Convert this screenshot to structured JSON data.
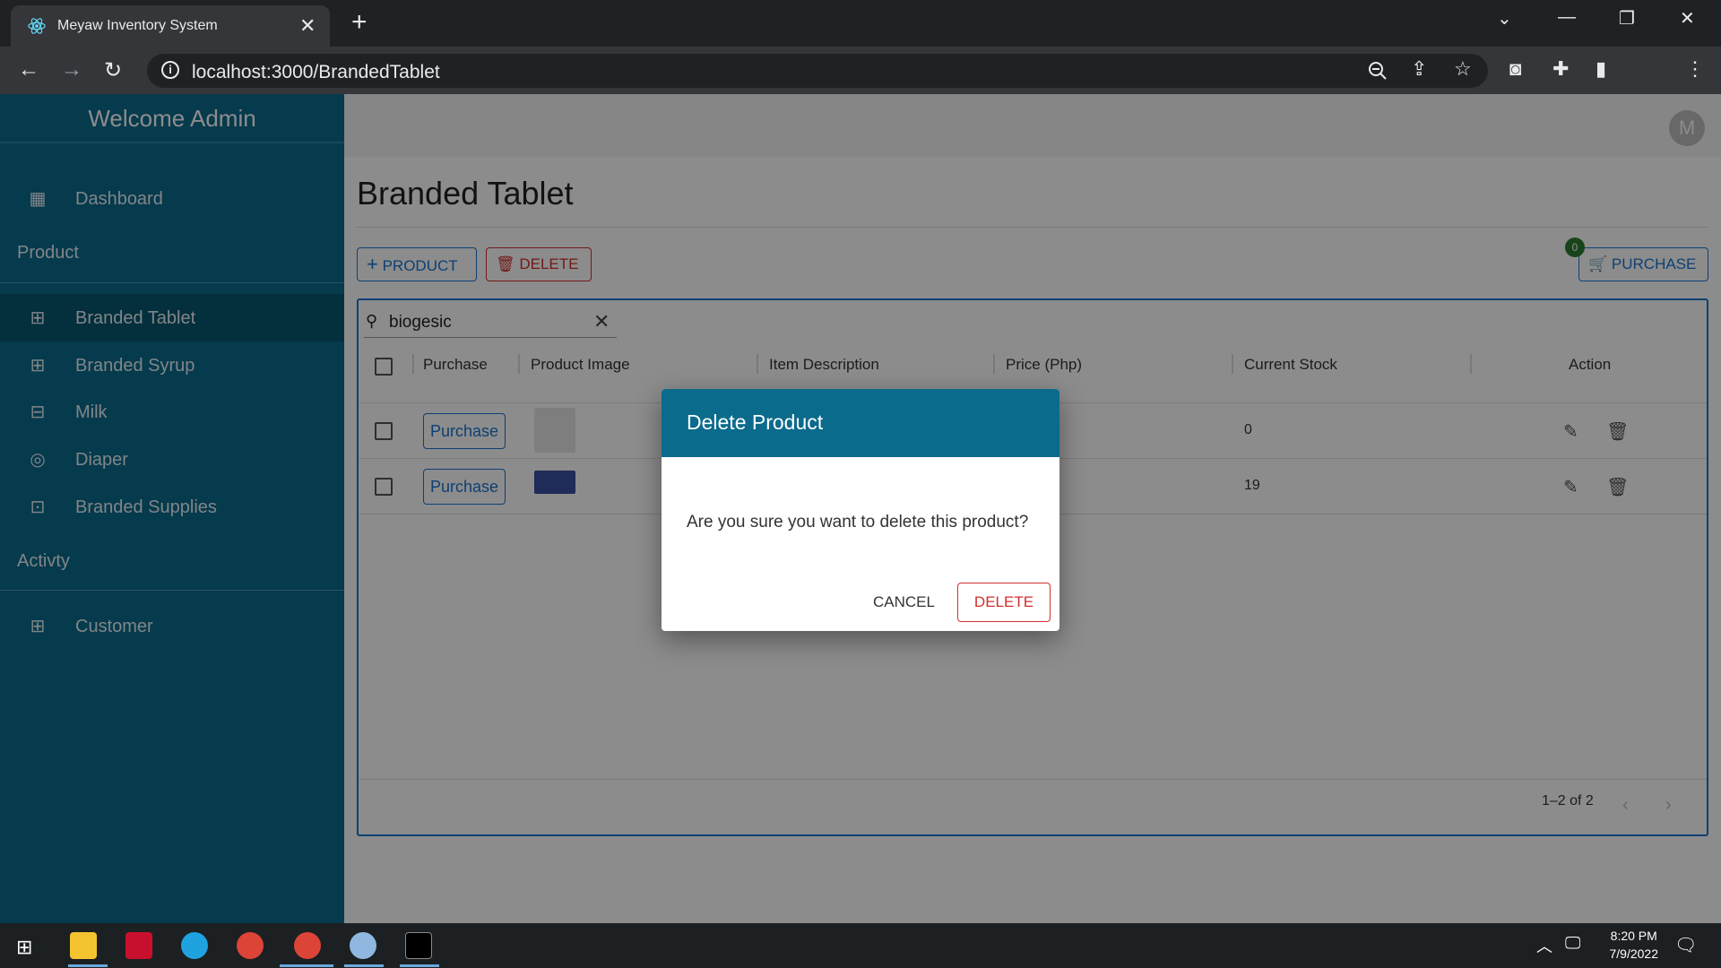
{
  "browser": {
    "tab_title": "Meyaw Inventory System",
    "url": "localhost:3000/BrandedTablet"
  },
  "sidebar": {
    "welcome": "Welcome Admin",
    "dashboard": "Dashboard",
    "section_product": "Product",
    "items": [
      {
        "label": "Branded Tablet",
        "icon": "medical-bag-icon"
      },
      {
        "label": "Branded Syrup",
        "icon": "medical-bag-icon"
      },
      {
        "label": "Milk",
        "icon": "milk-icon"
      },
      {
        "label": "Diaper",
        "icon": "diaper-icon"
      },
      {
        "label": "Branded Supplies",
        "icon": "archive-icon"
      }
    ],
    "section_activity": "Activty",
    "customer": "Customer"
  },
  "header": {
    "avatar": "M"
  },
  "page": {
    "title": "Branded Tablet",
    "add_product": "PRODUCT",
    "delete": "DELETE",
    "purchase": "PURCHASE",
    "cart_count": "0"
  },
  "grid": {
    "search_value": "biogesic",
    "columns": [
      "Purchase",
      "Product Image",
      "Item Description",
      "Price (Php)",
      "Current Stock",
      "Action"
    ],
    "rows": [
      {
        "purchase": "Purchase",
        "stock": "0"
      },
      {
        "purchase": "Purchase",
        "stock": "19"
      }
    ],
    "pagination": "1–2 of 2"
  },
  "dialog": {
    "title": "Delete Product",
    "message": "Are you sure you want to delete this product?",
    "cancel": "CANCEL",
    "confirm": "DELETE"
  },
  "taskbar": {
    "time": "8:20 PM",
    "date": "7/9/2022"
  }
}
